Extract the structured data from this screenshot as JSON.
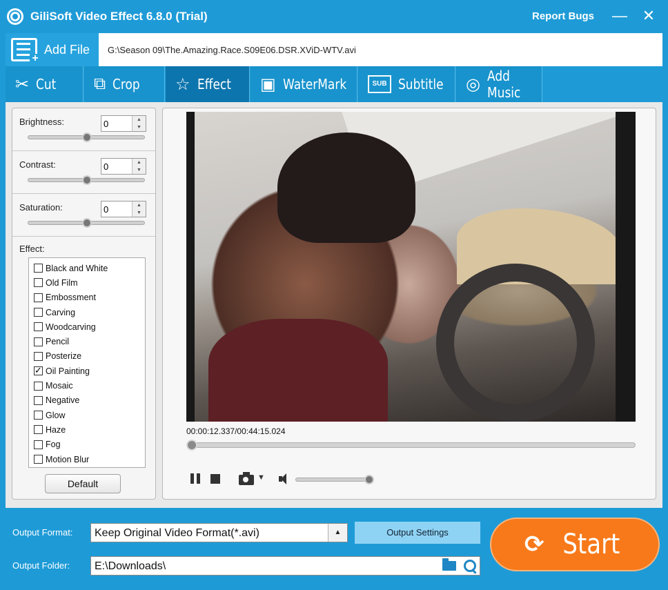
{
  "titlebar": {
    "title": "GiliSoft Video Effect 6.8.0 (Trial)",
    "report_bugs": "Report Bugs",
    "minimize": "—",
    "close": "✕"
  },
  "file": {
    "add_file_label": "Add File",
    "path": "G:\\Season 09\\The.Amazing.Race.S09E06.DSR.XViD-WTV.avi"
  },
  "tabs": [
    {
      "label": "Cut",
      "icon": "scissors-icon"
    },
    {
      "label": "Crop",
      "icon": "crop-icon"
    },
    {
      "label": "Effect",
      "icon": "star-icon"
    },
    {
      "label": "WaterMark",
      "icon": "drop-icon"
    },
    {
      "label": "Subtitle",
      "icon": "subtitle-icon",
      "icon_text": "SUB"
    },
    {
      "label": "Add Music",
      "icon": "music-icon"
    }
  ],
  "active_tab": "Effect",
  "adjustments": {
    "brightness": {
      "label": "Brightness:",
      "value": "0"
    },
    "contrast": {
      "label": "Contrast:",
      "value": "0"
    },
    "saturation": {
      "label": "Saturation:",
      "value": "0"
    }
  },
  "effects": {
    "title": "Effect:",
    "items": [
      {
        "label": "Black and White",
        "checked": false
      },
      {
        "label": "Old Film",
        "checked": false
      },
      {
        "label": "Embossment",
        "checked": false
      },
      {
        "label": "Carving",
        "checked": false
      },
      {
        "label": "Woodcarving",
        "checked": false
      },
      {
        "label": "Pencil",
        "checked": false
      },
      {
        "label": "Posterize",
        "checked": false
      },
      {
        "label": "Oil Painting",
        "checked": true
      },
      {
        "label": "Mosaic",
        "checked": false
      },
      {
        "label": "Negative",
        "checked": false
      },
      {
        "label": "Glow",
        "checked": false
      },
      {
        "label": "Haze",
        "checked": false
      },
      {
        "label": "Fog",
        "checked": false
      },
      {
        "label": "Motion Blur",
        "checked": false
      }
    ],
    "default_button": "Default"
  },
  "player": {
    "current_time": "00:00:12.337",
    "separator": "/",
    "total_time": "00:44:15.024",
    "seek_progress": 0.005,
    "volume_level": 0.9
  },
  "output": {
    "format_label": "Output Format:",
    "format_value": "Keep Original Video Format(*.avi)",
    "settings_button": "Output Settings",
    "folder_label": "Output Folder:",
    "folder_value": "E:\\Downloads\\",
    "start_button": "Start"
  },
  "colors": {
    "primary": "#1e9bd7",
    "active_tab": "#0d75ad",
    "start": "#f7791a"
  }
}
